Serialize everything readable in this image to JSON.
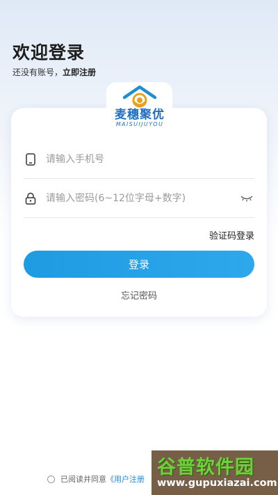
{
  "header": {
    "title": "欢迎登录",
    "subtitle_prefix": "还没有账号，",
    "register_link": "立即注册"
  },
  "logo": {
    "name_cn": "麦穗聚优",
    "name_en": "MAISUIJUYOU",
    "icon": "house-wheat-logo",
    "brand_color": "#1f6fc2",
    "accent_color": "#e8a21a"
  },
  "form": {
    "phone_placeholder": "请输入手机号",
    "phone_icon": "phone-icon",
    "password_placeholder": "请输入密码(6~12位字母+数字)",
    "password_icon": "lock-icon",
    "eye_icon": "eye-closed-icon",
    "code_login_label": "验证码登录",
    "login_button_label": "登录",
    "forgot_label": "忘记密码"
  },
  "agreement": {
    "text": "已阅读并同意",
    "terms_link": "《用户注册"
  },
  "watermark": {
    "cn": "谷普软件园",
    "en": "www.gupuxiazai.com"
  },
  "colors": {
    "primary": "#1e9be2",
    "link": "#1e8ad8"
  }
}
